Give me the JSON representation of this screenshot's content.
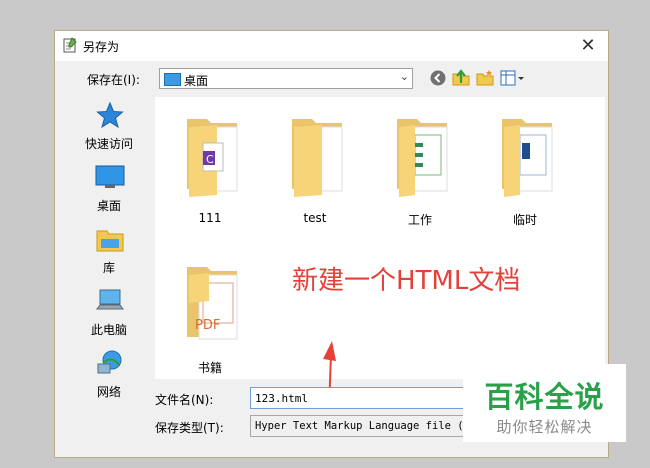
{
  "window": {
    "title": "另存为"
  },
  "toolbar": {
    "save_in_label": "保存在(I):",
    "location": "桌面"
  },
  "places": [
    {
      "label": "快速访问",
      "icon": "star-icon"
    },
    {
      "label": "桌面",
      "icon": "desktop-icon"
    },
    {
      "label": "库",
      "icon": "library-icon"
    },
    {
      "label": "此电脑",
      "icon": "computer-icon"
    },
    {
      "label": "网络",
      "icon": "network-icon"
    }
  ],
  "files": [
    {
      "name": "111",
      "kind": "c-file-folder-icon"
    },
    {
      "name": "test",
      "kind": "blank-folder-icon"
    },
    {
      "name": "工作",
      "kind": "spreadsheet-folder-icon"
    },
    {
      "name": "临时",
      "kind": "document-folder-icon"
    },
    {
      "name": "书籍",
      "kind": "pdf-folder-icon"
    }
  ],
  "annotation": "新建一个HTML文档",
  "form": {
    "filename_label": "文件名(N):",
    "filename_value": "123.html",
    "filetype_label": "保存类型(T):",
    "filetype_value": "Hyper Text Markup Language file (*.htm;*.html)"
  },
  "watermark": {
    "title": "百科全说",
    "subtitle": "助你轻松解决"
  },
  "colors": {
    "accent": "#3c9be3",
    "annotation": "#e5403a",
    "watermark": "#29a049"
  }
}
